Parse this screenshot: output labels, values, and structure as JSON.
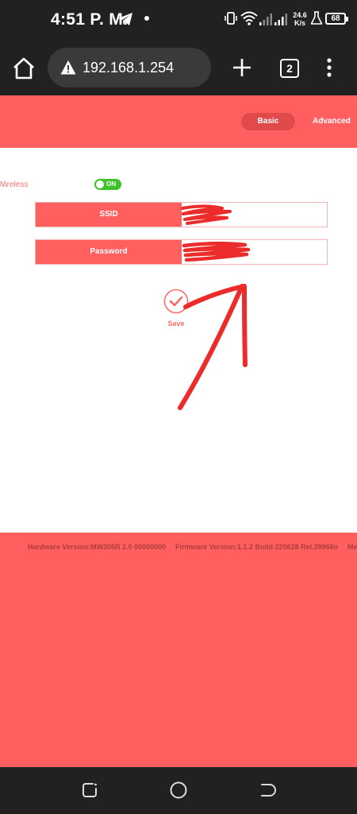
{
  "status_bar": {
    "time": "4:51 P. M.",
    "net_speed_value": "24.6",
    "net_speed_unit": "K/s",
    "battery": "68"
  },
  "browser": {
    "url": "192.168.1.254",
    "tab_count": "2"
  },
  "router": {
    "tabs": [
      {
        "label": "Basic",
        "active": true
      },
      {
        "label": "Advanced",
        "active": false
      }
    ],
    "wireless": {
      "label": "Wireless",
      "toggle_text": "ON",
      "enabled": true
    },
    "fields": {
      "ssid_label": "SSID",
      "ssid_value": "",
      "password_label": "Password",
      "password_value": ""
    },
    "save_label": "Save",
    "footer": {
      "hardware": "Hardware Version:MW305R 2.0 00000000",
      "firmware": "Firmware Version:1.1.2 Build 220628 Rel.39966n",
      "extra": "Me"
    }
  },
  "colors": {
    "accent": "#ff5f5f",
    "accent_dark": "#e14a4a",
    "toggle_on": "#3fc12a",
    "annotation": "#ec2b2b",
    "system_bar": "#212121"
  },
  "icons": {
    "status": [
      "telegram-icon",
      "vibrate-icon",
      "wifi-icon",
      "signal-icon",
      "flask-icon",
      "battery-icon"
    ],
    "browser": [
      "home-icon",
      "warning-icon",
      "plus-icon",
      "tabs-icon",
      "more-vert-icon"
    ],
    "page": [
      "check-circle-icon"
    ],
    "nav": [
      "recents-icon",
      "home-circle-icon",
      "back-icon"
    ]
  }
}
